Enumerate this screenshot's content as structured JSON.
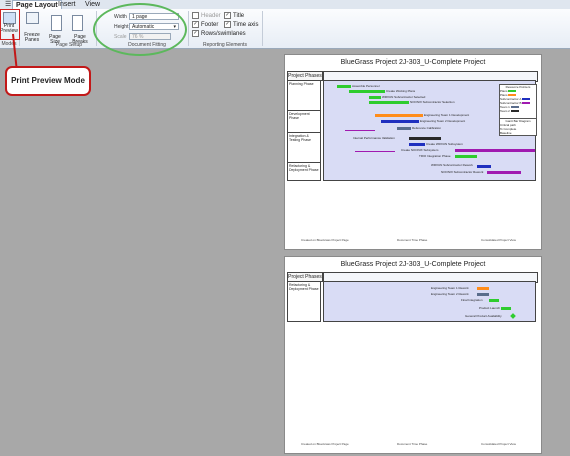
{
  "tabs": [
    "Page Layout",
    "Insert",
    "View"
  ],
  "ribbon": {
    "print_preview": "Print Preview",
    "modes_group": "Modes",
    "freeze_panes": "Freeze Panes",
    "page_size": "Page Size",
    "page_breaks": "Page Breaks",
    "page_setup_group": "Page Setup",
    "width_label": "Width",
    "width_value": "1 page",
    "height_label": "Height",
    "height_value": "Automatic",
    "scale_label": "Scale",
    "scale_value": "76 %",
    "document_fitting_group": "Document Fitting",
    "reporting_elements_group": "Reporting Elements",
    "header": "Header",
    "footer": "Footer",
    "rows_swimlanes": "Rows/swimlanes",
    "title": "Title",
    "time_axis": "Time axis"
  },
  "callout": "Print Preview Mode",
  "page1": {
    "title": "BlueGrass Project 2J-303_U-Complete Project",
    "col_header": "Project Phases",
    "phases": [
      "Planning Phase",
      "Development Phase",
      "Integration & Testing Phase",
      "Refactoring & Deployment Phase"
    ],
    "bar_labels": [
      "Assemble Personnel",
      "Create Working Plans",
      "WRXUN Subcontractor Selected",
      "NOONIX Subcontractor Selection",
      "Engineering Team 1 Development",
      "Engineering Team 2 Development",
      "Reference Calibration",
      "Internal Performance Validation",
      "Create WRXUN Subsystem",
      "Create NOONIX Subsystem",
      "TRIO Integration Phase",
      "WRXUN Subcontractor Rework",
      "NOONIX Subcontractor Rework"
    ],
    "legend_title": "Resource Pointers",
    "legend_items": [
      "Plans",
      "Plans",
      "Subcontractor A",
      "Subcontractor B",
      "Team 1",
      "Team 2"
    ],
    "legend2_title": "Gantt Bar Diagram",
    "legend2_items": [
      "Critical path",
      "% Complete",
      "Baseline"
    ],
    "footer_left": "Created on BlueGrass Project Page",
    "footer_mid": "Document Time Phase",
    "footer_right": "Consolidated Project View"
  },
  "page2": {
    "title": "BlueGrass Project 2J-303_U-Complete Project",
    "col_header": "Project Phases",
    "phases": [
      "Refactoring & Deployment Phase"
    ],
    "bar_labels": [
      "Engineering Team 1 Rework",
      "Engineering Team 2 Rework",
      "Final Integration",
      "Product Launch",
      "General Product Availability"
    ],
    "footer_left": "Created on BlueGrass Project Page",
    "footer_mid": "Document Time Phase",
    "footer_right": "Consolidated Project View"
  },
  "colors": {
    "green": "#2ecc2e",
    "orange": "#ff8c1a",
    "blue": "#1f2fbf",
    "purple": "#a01ab0",
    "slate": "#5a6d8c",
    "dark": "#2a2a2a",
    "red": "#d32020"
  }
}
